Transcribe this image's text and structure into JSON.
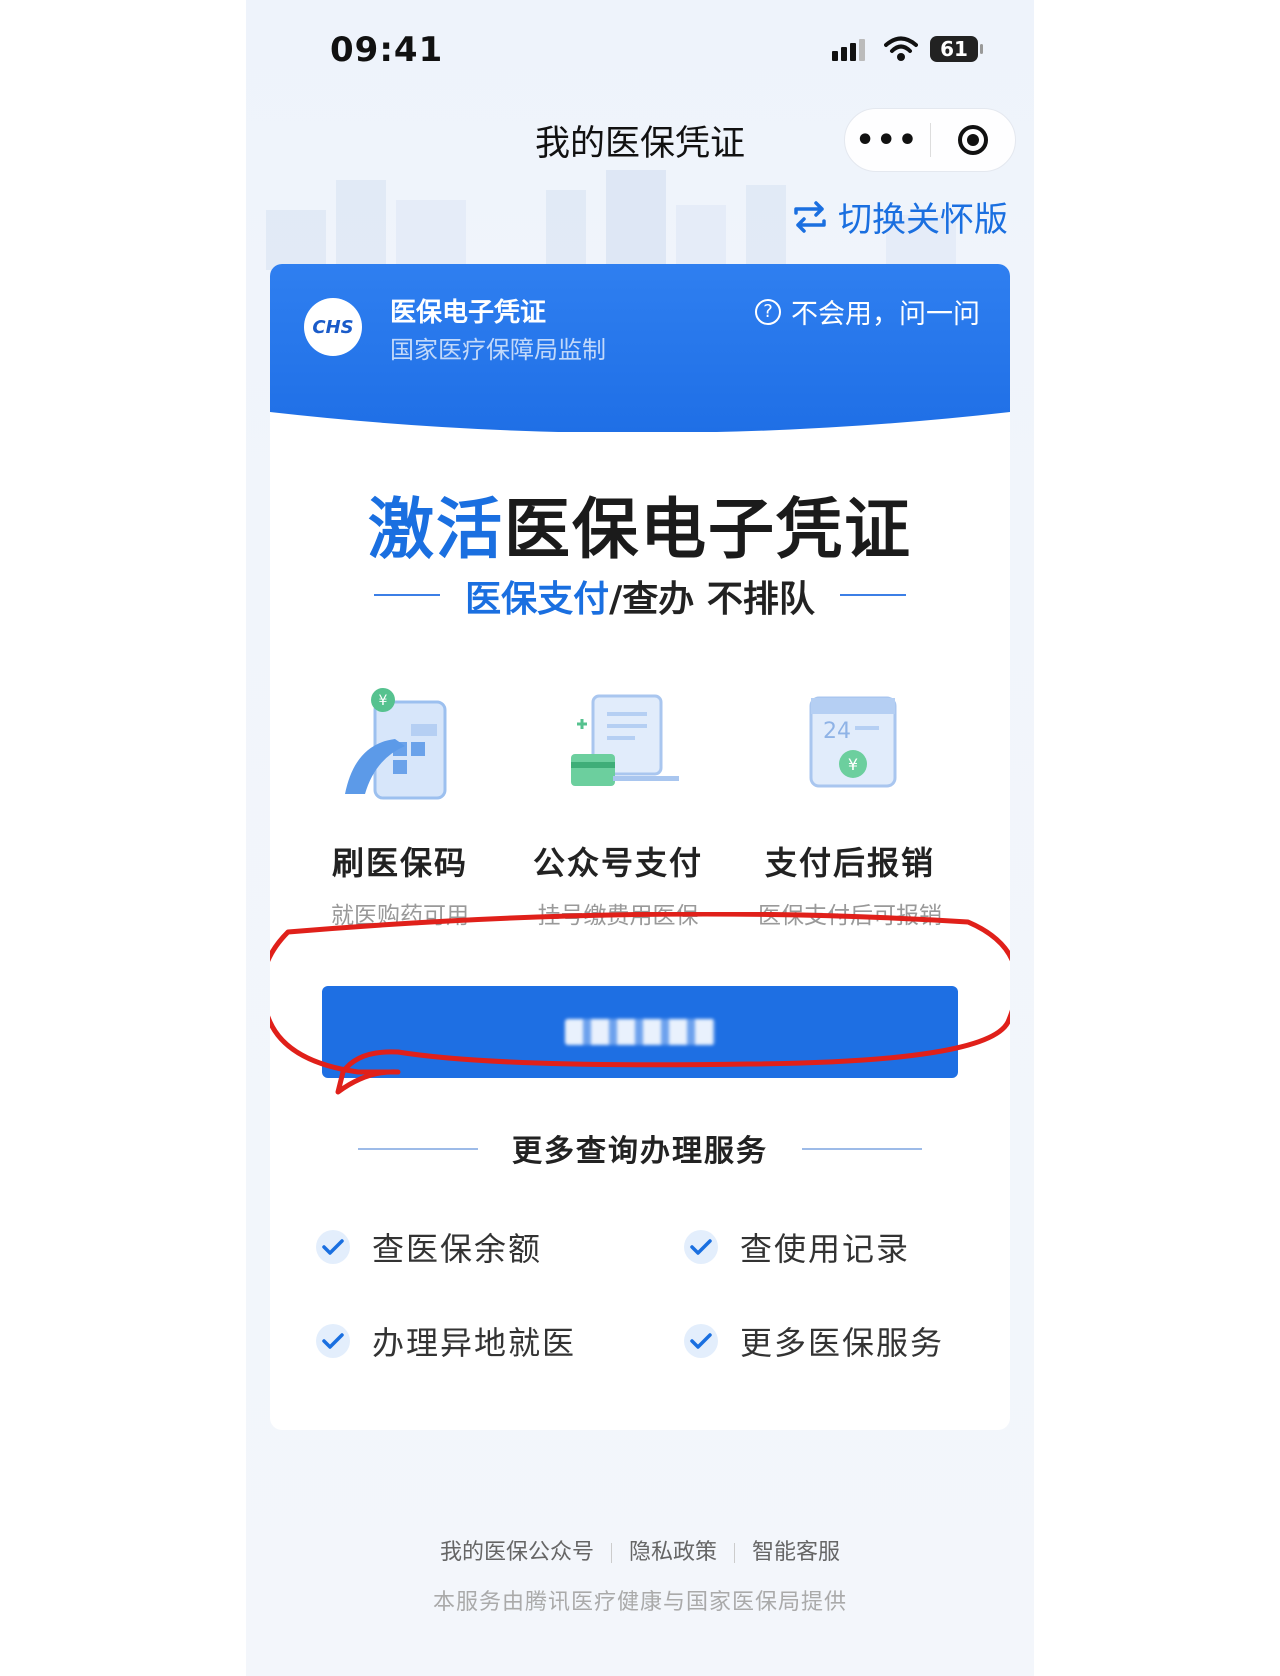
{
  "status_bar": {
    "time": "09:41",
    "battery": "61"
  },
  "nav": {
    "title": "我的医保凭证",
    "more_label": "•••"
  },
  "switch_care": {
    "label": "切换关怀版"
  },
  "card_header": {
    "logo_text": "CHS",
    "title": "医保电子凭证",
    "subtitle": "国家医疗保障局监制",
    "help": "不会用，问一问"
  },
  "hero": {
    "title_blue": "激活",
    "title_rest": "医保电子凭证",
    "subtitle_blue": "医保支付",
    "subtitle_rest": "/查办 不排队"
  },
  "features": [
    {
      "name": "刷医保码",
      "desc": "就医购药可用",
      "icon": "phone-qr-icon"
    },
    {
      "name": "公众号支付",
      "desc": "挂号缴费用医保",
      "icon": "desk-payment-icon"
    },
    {
      "name": "支付后报销",
      "desc": "医保支付后可报销",
      "icon": "calendar-yuan-icon"
    }
  ],
  "cta": {
    "label": ""
  },
  "more_services": {
    "title": "更多查询办理服务",
    "items": [
      "查医保余额",
      "查使用记录",
      "办理异地就医",
      "更多医保服务"
    ]
  },
  "footer": {
    "links": [
      "我的医保公众号",
      "隐私政策",
      "智能客服"
    ],
    "note": "本服务由腾讯医疗健康与国家医保局提供"
  },
  "colors": {
    "accent": "#1e6fe3",
    "annotation": "#e0201a"
  }
}
